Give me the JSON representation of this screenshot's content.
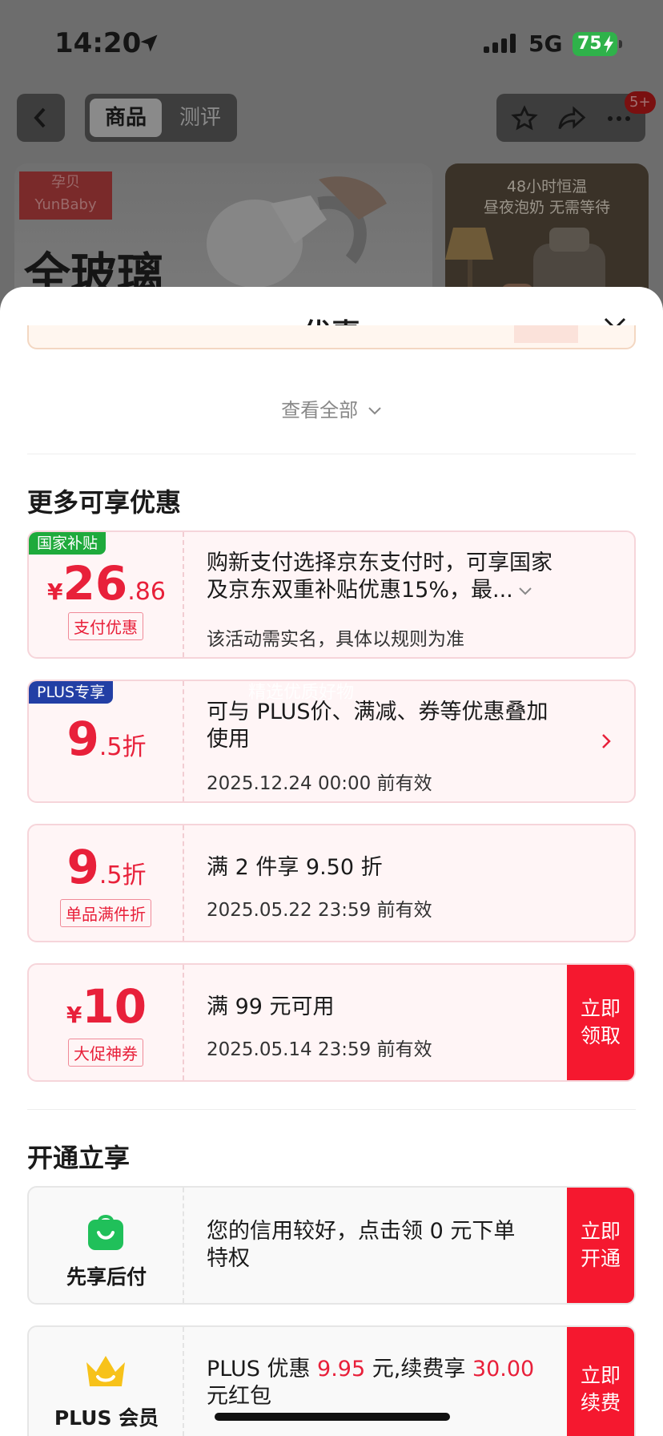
{
  "status_bar": {
    "time": "14:20",
    "network": "5G",
    "battery": "75"
  },
  "nav": {
    "tab_active": "商品",
    "tab_inactive": "测评",
    "message_badge": "5+"
  },
  "banner": {
    "brand_cn": "孕贝",
    "brand_en": "YunBaby",
    "headline": "全玻璃",
    "side_line1": "48小时恒温",
    "side_line2": "昼夜泡奶 无需等待"
  },
  "sheet": {
    "title": "优惠",
    "view_all": "查看全部",
    "section_more": "更多可享优惠",
    "section_open": "开通立享",
    "watermark": "精选优质好物"
  },
  "offers": [
    {
      "tag": "国家补贴",
      "currency": "¥",
      "amount_int": "26",
      "amount_dec": ".86",
      "label": "支付优惠",
      "line1": "购新支付选择京东支付时，可享国家",
      "line2": "及京东双重补贴优惠15%，最...",
      "sub": "该活动需实名，具体以规则为准"
    },
    {
      "tag": "PLUS专享",
      "amount_int": "9",
      "amount_dec": ".5",
      "unit": "折",
      "line1": "可与 PLUS价、满减、券等优惠叠加",
      "line2": "使用",
      "sub": "2025.12.24 00:00 前有效"
    },
    {
      "amount_int": "9",
      "amount_dec": ".5",
      "unit": "折",
      "label": "单品满件折",
      "line1": "满 2 件享 9.50 折",
      "sub": "2025.05.22 23:59 前有效"
    },
    {
      "currency": "¥",
      "amount_int": "10",
      "label": "大促神券",
      "line1": "满 99 元可用",
      "sub": "2025.05.14 23:59 前有效",
      "action": "立即领取"
    }
  ],
  "services": [
    {
      "icon": "shopping-bag-icon",
      "name": "先享后付",
      "line1": "您的信用较好，点击领 0 元下单",
      "line2": "特权",
      "action": "立即开通"
    },
    {
      "icon": "crown-icon",
      "name": "PLUS 会员",
      "text_a": "PLUS 优惠 ",
      "highlight_a": "9.95",
      "text_b": " 元,续费享 ",
      "highlight_b": "30.00",
      "line2": "元红包",
      "action": "立即续费"
    }
  ],
  "colors": {
    "accent_red": "#f5182f",
    "price_red": "#e8203a",
    "tag_green": "#1faa3c",
    "tag_blue": "#233fa5"
  }
}
